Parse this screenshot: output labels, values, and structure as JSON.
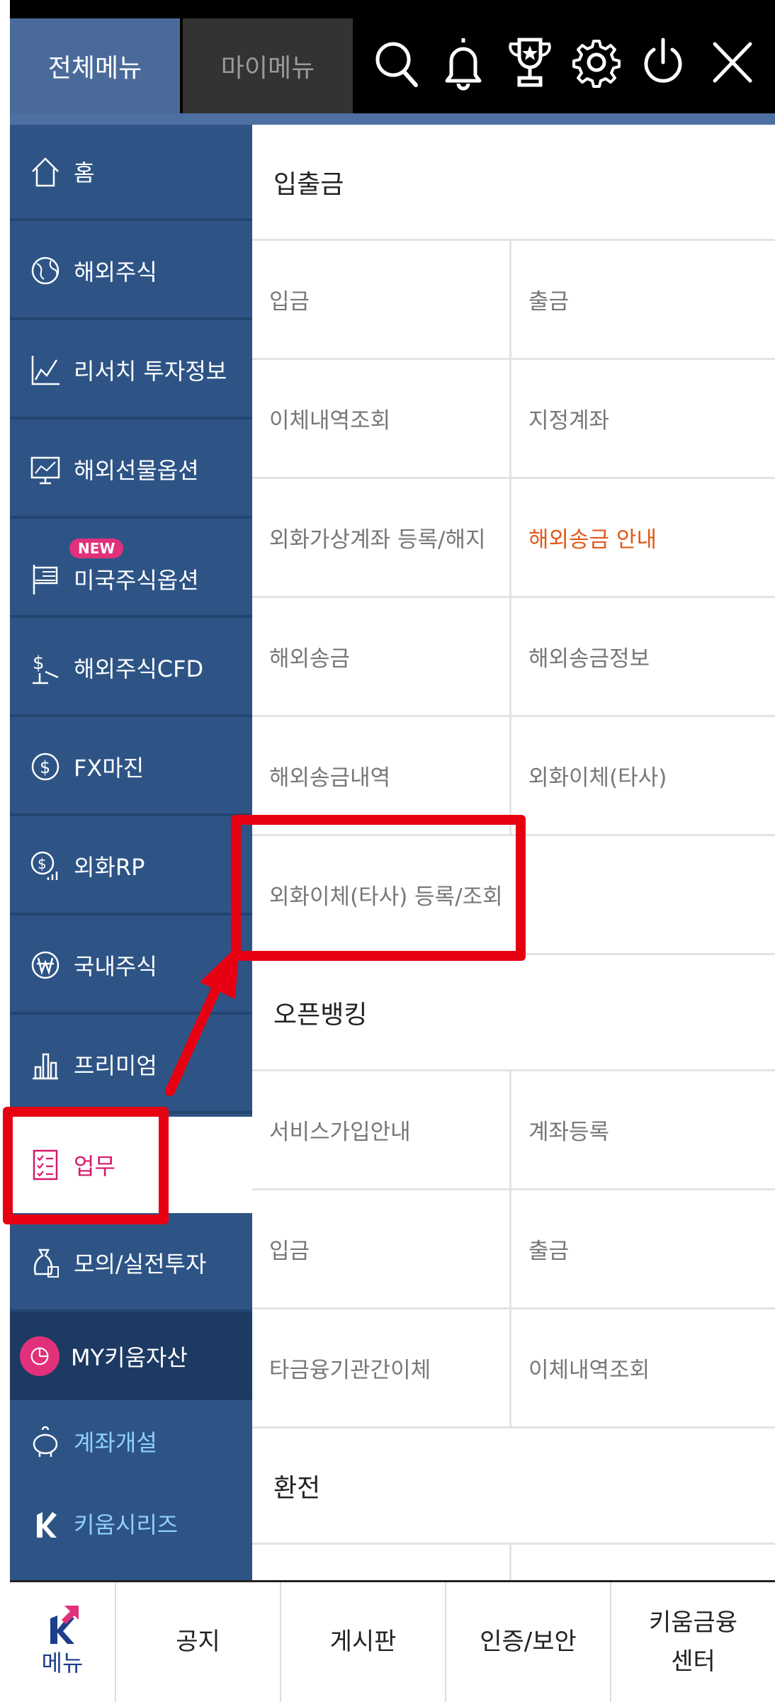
{
  "header": {
    "tabs": [
      {
        "label": "전체메뉴"
      },
      {
        "label": "마이메뉴"
      }
    ],
    "icons": [
      "search-icon",
      "bell-icon",
      "trophy-icon",
      "gear-icon",
      "power-icon",
      "close-icon"
    ]
  },
  "sidebar": {
    "items": [
      {
        "label": "홈",
        "icon": "home-icon"
      },
      {
        "label": "해외주식",
        "icon": "globe-icon"
      },
      {
        "label": "리서치 투자정보",
        "icon": "chart-icon"
      },
      {
        "label": "해외선물옵션",
        "icon": "monitor-chart-icon"
      },
      {
        "label": "미국주식옵션",
        "icon": "flag-icon",
        "badge": "NEW"
      },
      {
        "label": "해외주식CFD",
        "icon": "dollar-scale-icon"
      },
      {
        "label": "FX마진",
        "icon": "dollar-circle-icon"
      },
      {
        "label": "외화RP",
        "icon": "dollar-growth-icon"
      },
      {
        "label": "국내주식",
        "icon": "won-circle-icon"
      },
      {
        "label": "프리미엄",
        "icon": "bar-icon"
      },
      {
        "label": "업무",
        "icon": "checklist-icon"
      },
      {
        "label": "모의/실전투자",
        "icon": "money-bag-icon"
      },
      {
        "label": "MY키움자산",
        "icon": "pie-icon"
      },
      {
        "label": "계좌개설",
        "icon": "piggy-icon"
      },
      {
        "label": "키움시리즈",
        "icon": "k-logo-icon"
      }
    ]
  },
  "content": {
    "sections": [
      {
        "title": "입출금",
        "items": [
          "입금",
          "출금",
          "이체내역조회",
          "지정계좌",
          "외화가상계좌 등록/해지",
          "해외송금 안내",
          "해외송금",
          "해외송금정보",
          "해외송금내역",
          "외화이체(타사)",
          "외화이체(타사) 등록/조회"
        ]
      },
      {
        "title": "오픈뱅킹",
        "items": [
          "서비스가입안내",
          "계좌등록",
          "입금",
          "출금",
          "타금융기관간이체",
          "이체내역조회"
        ]
      },
      {
        "title": "환전",
        "items": []
      }
    ]
  },
  "bottom": {
    "menu_label": "메뉴",
    "items": [
      "공지",
      "게시판",
      "인증/보안",
      "키움금융\n센터"
    ]
  },
  "colors": {
    "sidebar": "#2e5486",
    "active": "#d6196d",
    "highlight": "#e60012",
    "orange_text": "#e05a1a"
  }
}
